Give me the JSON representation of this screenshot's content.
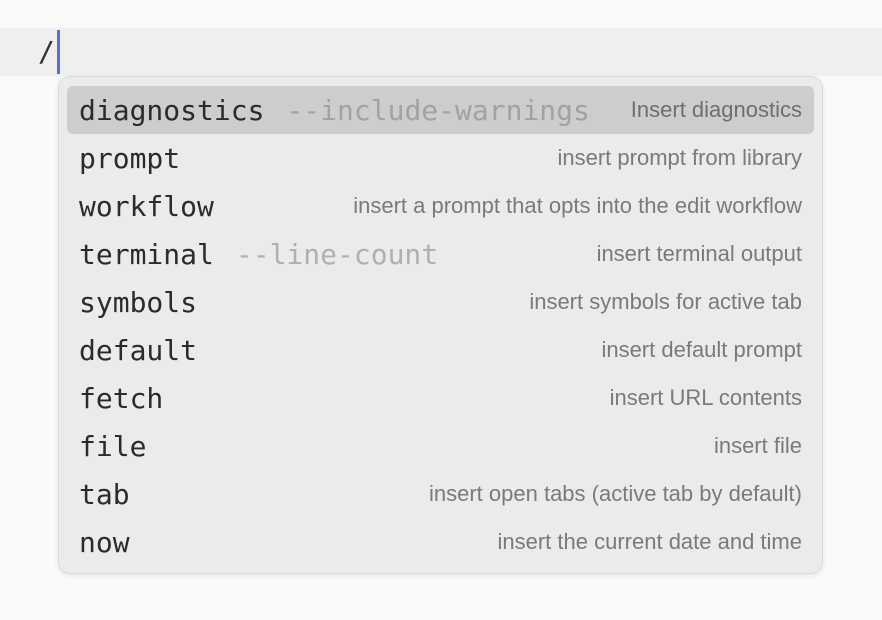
{
  "editor": {
    "input_text": "/"
  },
  "completions": [
    {
      "command": "diagnostics",
      "args": "--include-warnings",
      "description": "Insert diagnostics",
      "selected": true
    },
    {
      "command": "prompt",
      "args": "",
      "description": "insert prompt from library",
      "selected": false
    },
    {
      "command": "workflow",
      "args": "",
      "description": "insert a prompt that opts into the edit workflow",
      "selected": false
    },
    {
      "command": "terminal",
      "args": "--line-count",
      "description": "insert terminal output",
      "selected": false
    },
    {
      "command": "symbols",
      "args": "",
      "description": "insert symbols for active tab",
      "selected": false
    },
    {
      "command": "default",
      "args": "",
      "description": "insert default prompt",
      "selected": false
    },
    {
      "command": "fetch",
      "args": "",
      "description": "insert URL contents",
      "selected": false
    },
    {
      "command": "file",
      "args": "",
      "description": "insert file",
      "selected": false
    },
    {
      "command": "tab",
      "args": "",
      "description": "insert open tabs (active tab by default)",
      "selected": false
    },
    {
      "command": "now",
      "args": "",
      "description": "insert the current date and time",
      "selected": false
    }
  ],
  "colors": {
    "cursor": "#5a6fd6",
    "selected_row": "#cdcdcd",
    "popup_background": "#ebebeb"
  }
}
